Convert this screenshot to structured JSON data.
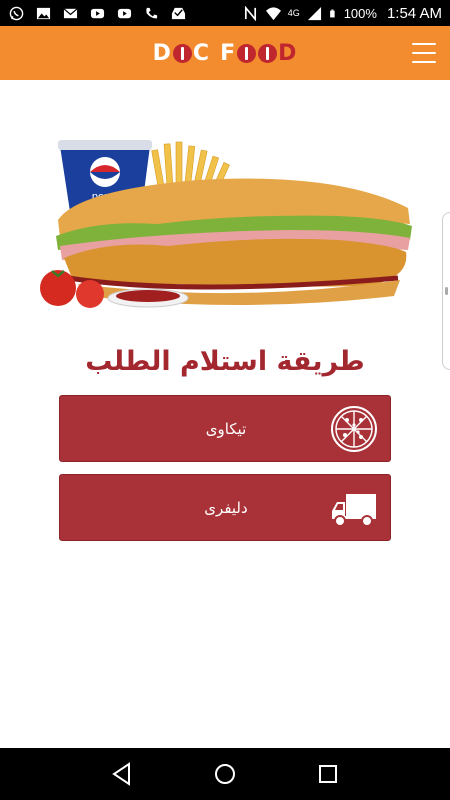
{
  "status_bar": {
    "network_label": "4G",
    "battery": "100%",
    "time": "1:54 AM",
    "left_icons": [
      "whatsapp-icon",
      "image-icon",
      "email-icon",
      "youtube-icon",
      "youtube-icon",
      "phone-icon",
      "inbox-icon"
    ],
    "right_icons": [
      "nfc-icon",
      "wifi-icon",
      "signal-icon",
      "battery-icon"
    ]
  },
  "header": {
    "logo": {
      "text_left": "D",
      "text_right": "F",
      "text_end": "D"
    },
    "menu_icon": "hamburger-menu-icon",
    "color": "#f28c2f"
  },
  "hero": {
    "image": "burger-fries-pepsi-combo"
  },
  "section": {
    "title": "طريقة استلام الطلب"
  },
  "options": [
    {
      "label": "تیکاوی",
      "icon": "pizza-icon"
    },
    {
      "label": "دلیفری",
      "icon": "delivery-truck-icon"
    }
  ],
  "colors": {
    "accent": "#f28c2f",
    "brand_red": "#a3272f",
    "button": "#a83238"
  },
  "nav_bar": {
    "icons": [
      "back-icon",
      "home-icon",
      "recents-icon"
    ]
  }
}
